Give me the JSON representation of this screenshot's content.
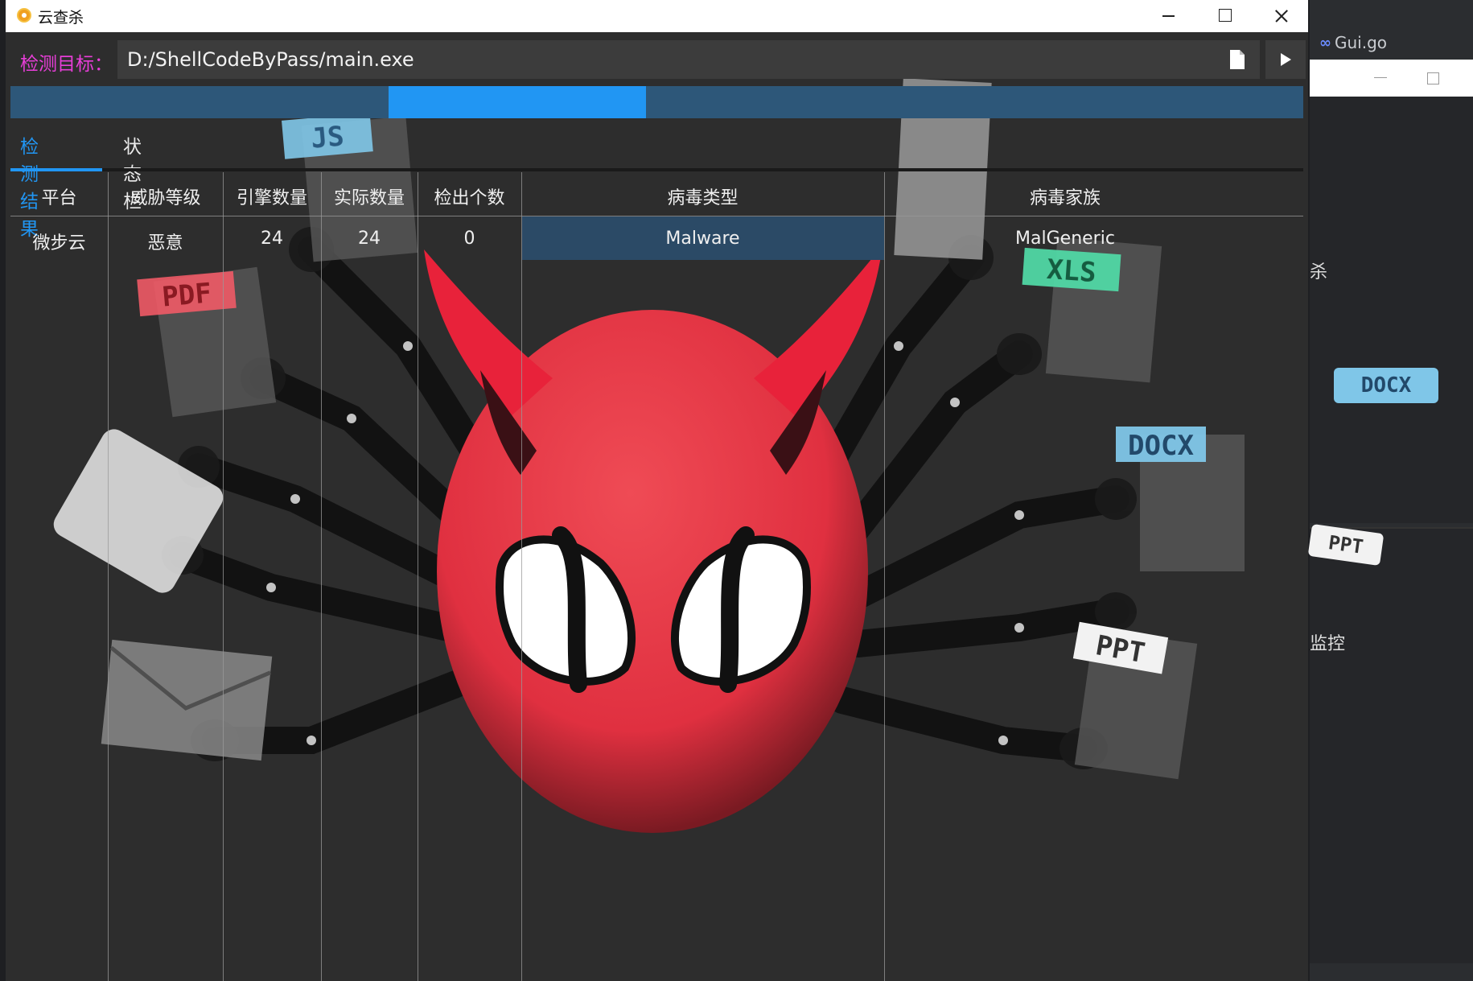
{
  "background_app": {
    "tab_label": "Gui.go",
    "side_labels": [
      "杀",
      "监控"
    ],
    "file_badges": [
      "DOCX",
      "PPT"
    ]
  },
  "window": {
    "title": "云查杀",
    "controls": {
      "minimize": "minimize-icon",
      "maximize": "maximize-icon",
      "close": "close-icon"
    }
  },
  "target": {
    "label": "检测目标：",
    "path": "D:/ShellCodeByPass/main.exe"
  },
  "progress": {
    "value": 0.23
  },
  "tabs": [
    {
      "label": "检测结果",
      "active": true
    },
    {
      "label": "状态栏",
      "active": false
    }
  ],
  "table": {
    "headers": [
      "平台",
      "威胁等级",
      "引擎数量",
      "实际数量",
      "检出个数",
      "病毒类型",
      "病毒家族"
    ],
    "rows": [
      [
        "微步云",
        "恶意",
        "24",
        "24",
        "0",
        "Malware",
        "MalGeneric"
      ]
    ]
  },
  "artwork": {
    "file_badges": [
      "JS",
      "PDF",
      "XLS",
      "DOCX",
      "PPT"
    ]
  },
  "colors": {
    "accent": "#2196f3",
    "label_magenta": "#e83ed8",
    "mascot_red": "#e63946"
  }
}
